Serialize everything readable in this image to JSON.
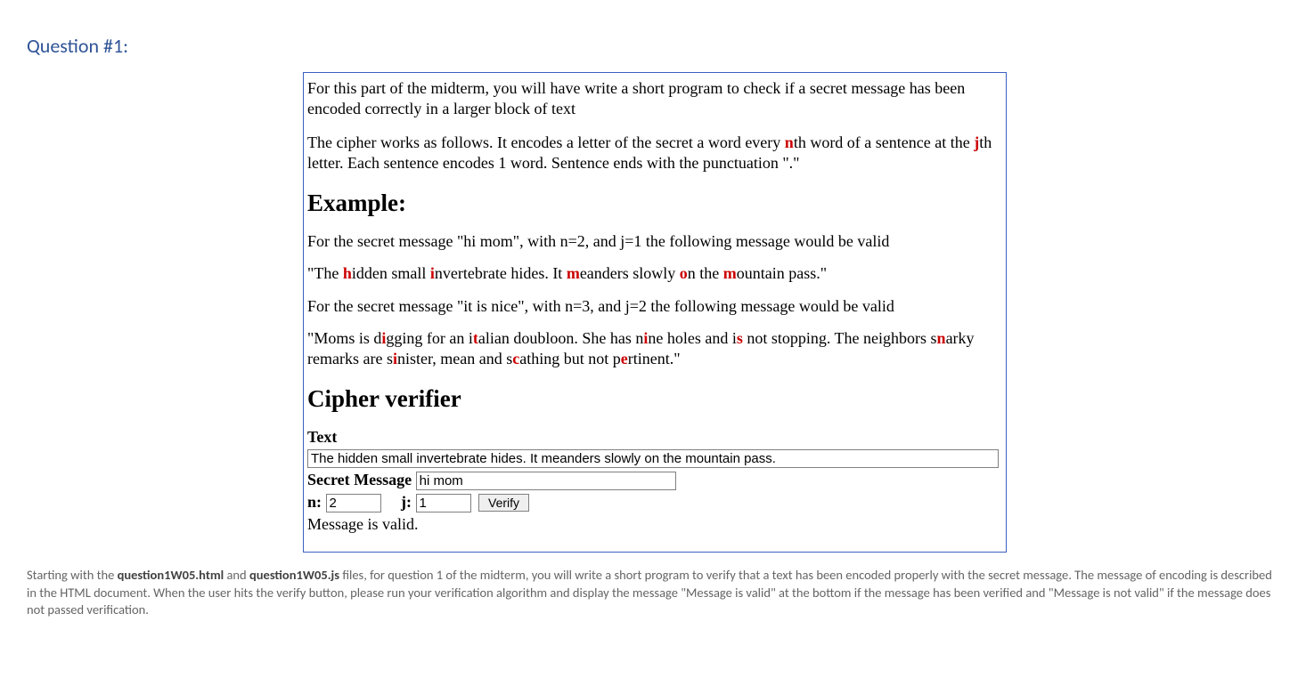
{
  "title": "Question #1:",
  "intro": {
    "p1": "For this part of the midterm, you will have write a short program to check if a secret message has been encoded correctly in a larger block of text",
    "p2_pre": "The cipher works as follows. It encodes a letter of the secret a word every ",
    "p2_n": "n",
    "p2_mid": "th word of a sentence at the ",
    "p2_j": "j",
    "p2_post": "th letter. Each sentence encodes 1 word. Sentence ends with the punctuation \".\""
  },
  "example_heading": "Example:",
  "ex1_lead": "For the secret message \"hi mom\", with n=2, and j=1 the following message would be valid",
  "ex1_text": {
    "parts": [
      "\"The ",
      "h",
      "idden small ",
      "i",
      "nvertebrate hides. It ",
      "m",
      "eanders slowly ",
      "o",
      "n the ",
      "m",
      "ountain pass.\""
    ],
    "red_indices": [
      1,
      3,
      5,
      7,
      9
    ]
  },
  "ex2_lead": "For the secret message \"it is nice\", with n=3, and j=2 the following message would be valid",
  "ex2_text": {
    "parts": [
      "\"Moms is d",
      "i",
      "gging for an i",
      "t",
      "alian doubloon. She has n",
      "i",
      "ne holes and i",
      "s",
      " not stopping. The neighbors s",
      "n",
      "arky remarks are s",
      "i",
      "nister, mean and s",
      "c",
      "athing but not p",
      "e",
      "rtinent.\""
    ],
    "red_indices": [
      1,
      3,
      5,
      7,
      9,
      11,
      13,
      15
    ]
  },
  "verifier_heading": "Cipher verifier",
  "form": {
    "text_label": "Text",
    "text_value": "The hidden small invertebrate hides. It meanders slowly on the mountain pass.",
    "secret_label": "Secret Message",
    "secret_value": "hi mom",
    "n_label": "n:",
    "n_value": "2",
    "j_label": "j:",
    "j_value": "1",
    "verify_label": "Verify",
    "result": "Message is valid."
  },
  "instructions": {
    "t1": "Starting with the ",
    "f1": "question1W05.html",
    "t2": " and ",
    "f2": "question1W05.js",
    "t3": " files, for question 1 of the midterm, you will write a short program to verify that a text has been encoded properly with the secret message. The message of encoding is described in the HTML document. When the user hits the verify button, please run your verification algorithm and display the message \"Message is valid\" at the bottom if the message has been verified and \"Message is not valid\" if the message does not passed verification."
  }
}
